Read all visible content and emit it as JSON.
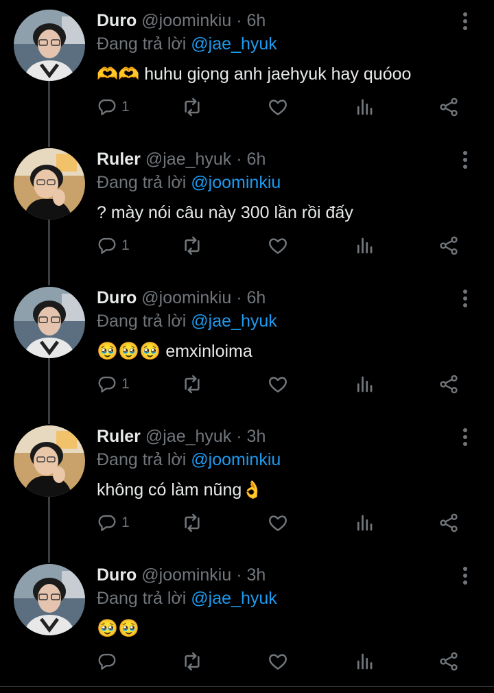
{
  "tweets": [
    {
      "name": "Duro",
      "handle": "@joominkiu",
      "sep": "·",
      "time": "6h",
      "reply_prefix": "Đang trả lời",
      "reply_to": "@jae_hyuk",
      "text": "🫶🫶 huhu giọng anh jaehyuk hay quóoo",
      "reply_count": "1",
      "avatar": "duro"
    },
    {
      "name": "Ruler",
      "handle": "@jae_hyuk",
      "sep": "·",
      "time": "6h",
      "reply_prefix": "Đang trả lời",
      "reply_to": "@joominkiu",
      "text": "? mày nói câu này 300 lần rồi đấy",
      "reply_count": "1",
      "avatar": "ruler"
    },
    {
      "name": "Duro",
      "handle": "@joominkiu",
      "sep": "·",
      "time": "6h",
      "reply_prefix": "Đang trả lời",
      "reply_to": "@jae_hyuk",
      "text": "🥹🥹🥹 emxinloima",
      "reply_count": "1",
      "avatar": "duro"
    },
    {
      "name": "Ruler",
      "handle": "@jae_hyuk",
      "sep": "·",
      "time": "3h",
      "reply_prefix": "Đang trả lời",
      "reply_to": "@joominkiu",
      "text": "không có làm nũng👌",
      "reply_count": "1",
      "avatar": "ruler"
    },
    {
      "name": "Duro",
      "handle": "@joominkiu",
      "sep": "·",
      "time": "3h",
      "reply_prefix": "Đang trả lời",
      "reply_to": "@jae_hyuk",
      "text": "🥹🥹",
      "reply_count": "",
      "avatar": "duro"
    }
  ],
  "icons": {
    "reply": "reply-icon",
    "retweet": "retweet-icon",
    "like": "heart-icon",
    "views": "views-icon",
    "share": "share-icon",
    "more": "more-vertical-icon"
  },
  "colors": {
    "background": "#000000",
    "text": "#e7e9ea",
    "muted": "#71767b",
    "mention": "#1d9bf0"
  }
}
